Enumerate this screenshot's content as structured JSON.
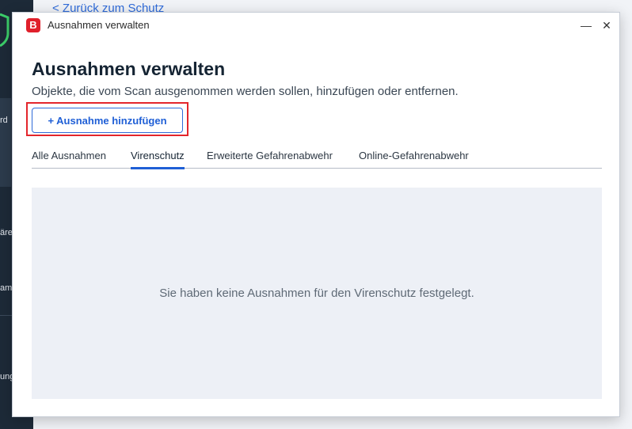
{
  "background": {
    "back_link": "< Zurück zum Schutz",
    "sidebar_fragments": [
      "rd",
      "äre",
      "amm",
      "ung"
    ]
  },
  "window": {
    "title": "Ausnahmen verwalten",
    "logo_letter": "B",
    "minimize_glyph": "—",
    "close_glyph": "✕"
  },
  "header": {
    "title": "Ausnahmen verwalten",
    "subtitle": "Objekte, die vom Scan ausgenommen werden sollen, hinzufügen oder entfernen."
  },
  "add_button": {
    "label": "+ Ausnahme hinzufügen"
  },
  "tabs": [
    {
      "label": "Alle Ausnahmen",
      "active": false
    },
    {
      "label": "Virenschutz",
      "active": true
    },
    {
      "label": "Erweiterte Gefahrenabwehr",
      "active": false
    },
    {
      "label": "Online-Gefahrenabwehr",
      "active": false
    }
  ],
  "empty_state": {
    "message": "Sie haben keine Ausnahmen für den Virenschutz festgelegt."
  },
  "colors": {
    "accent": "#1f5fd6",
    "brand": "#e0202b",
    "highlight": "#e3262c",
    "sidebar": "#1d2a38"
  }
}
